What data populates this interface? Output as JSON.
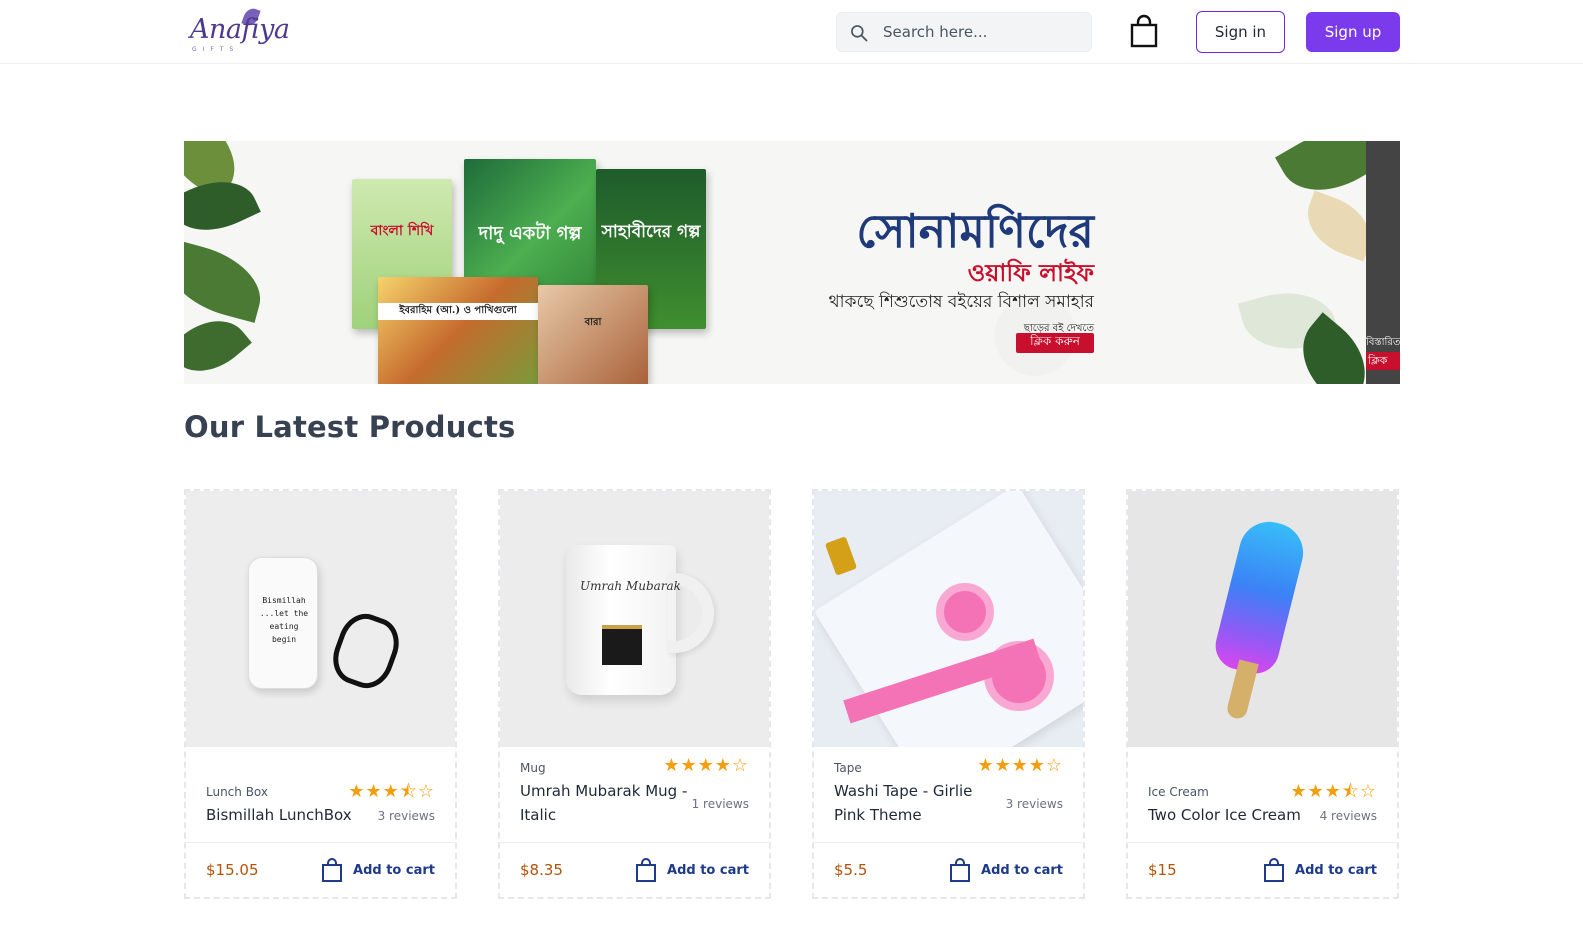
{
  "header": {
    "logo_text": "Anafiya",
    "logo_sub": "GIFTS",
    "search_placeholder": "Search here...",
    "signin_label": "Sign in",
    "signup_label": "Sign up",
    "accent_color": "#7c3aed"
  },
  "banner": {
    "headline": "সোনামণিদের",
    "subheadline": "ওয়াফি লাইফ",
    "tagline": "থাকছে শিশুতোষ বইয়ের বিশাল সমাহার",
    "small_text": "ছাড়ের বই দেখতে",
    "cta_label": "ক্লিক করুন",
    "next_slide_text": "বিস্তারিত",
    "next_slide_cta": "ক্লিক",
    "book_titles": [
      "বাংলা শিখি",
      "দাদু একটা গল্প",
      "সাহাবীদের গল্প",
      "ইবরাহিম (আ.) ও পাখিগুলো",
      "বারা"
    ]
  },
  "section": {
    "title": "Our Latest Products"
  },
  "products": [
    {
      "category": "Lunch Box",
      "name": "Bismillah LunchBox",
      "rating": 3.5,
      "stars": "★★★⯪☆",
      "reviews": "3 reviews",
      "price": "$15.05",
      "add_label": "Add to cart",
      "image_text": "Bismillah ...let the eating begin",
      "icon": "lunchbox-icon"
    },
    {
      "category": "Mug",
      "name": "Umrah Mubarak Mug - Italic",
      "rating": 4,
      "stars": "★★★★☆",
      "reviews": "1 reviews",
      "price": "$8.35",
      "add_label": "Add to cart",
      "image_text": "Umrah Mubarak",
      "icon": "mug-icon"
    },
    {
      "category": "Tape",
      "name": "Washi Tape - Girlie Pink Theme",
      "rating": 4,
      "stars": "★★★★☆",
      "reviews": "3 reviews",
      "price": "$5.5",
      "add_label": "Add to cart",
      "icon": "tape-icon"
    },
    {
      "category": "Ice Cream",
      "name": "Two Color Ice Cream",
      "rating": 3.5,
      "stars": "★★★⯪☆",
      "reviews": "4 reviews",
      "price": "$15",
      "add_label": "Add to cart",
      "icon": "icecream-icon"
    }
  ]
}
